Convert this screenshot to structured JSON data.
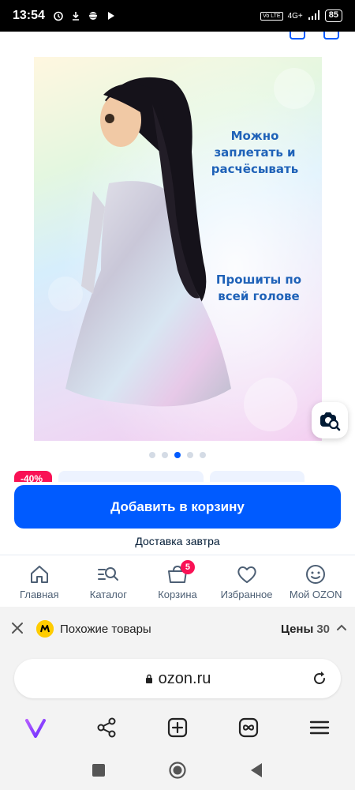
{
  "status_bar": {
    "time": "13:54",
    "network": "4G+",
    "volte": "Vo LTE",
    "battery": "85"
  },
  "product": {
    "image_caption_1": "Можно заплетать и расчёсывать",
    "image_caption_2": "Прошиты по всей голове",
    "gallery": {
      "total": 5,
      "active_index": 2
    },
    "badges": {
      "discount": "-40%"
    }
  },
  "actions": {
    "add_to_cart": "Добавить в корзину",
    "delivery": "Доставка завтра"
  },
  "bottom_nav": {
    "items": [
      {
        "label": "Главная",
        "icon": "home-icon"
      },
      {
        "label": "Каталог",
        "icon": "catalog-search-icon"
      },
      {
        "label": "Корзина",
        "icon": "cart-icon",
        "badge": "5"
      },
      {
        "label": "Избранное",
        "icon": "heart-icon"
      },
      {
        "label": "Мой OZON",
        "icon": "smiley-icon"
      }
    ]
  },
  "similar_bar": {
    "label": "Похожие товары",
    "prices_label": "Цены",
    "prices_count": "30"
  },
  "browser": {
    "url": "ozon.ru"
  },
  "colors": {
    "accent": "#005bff",
    "discount": "#f91155",
    "caption_text": "#1f62b8"
  }
}
